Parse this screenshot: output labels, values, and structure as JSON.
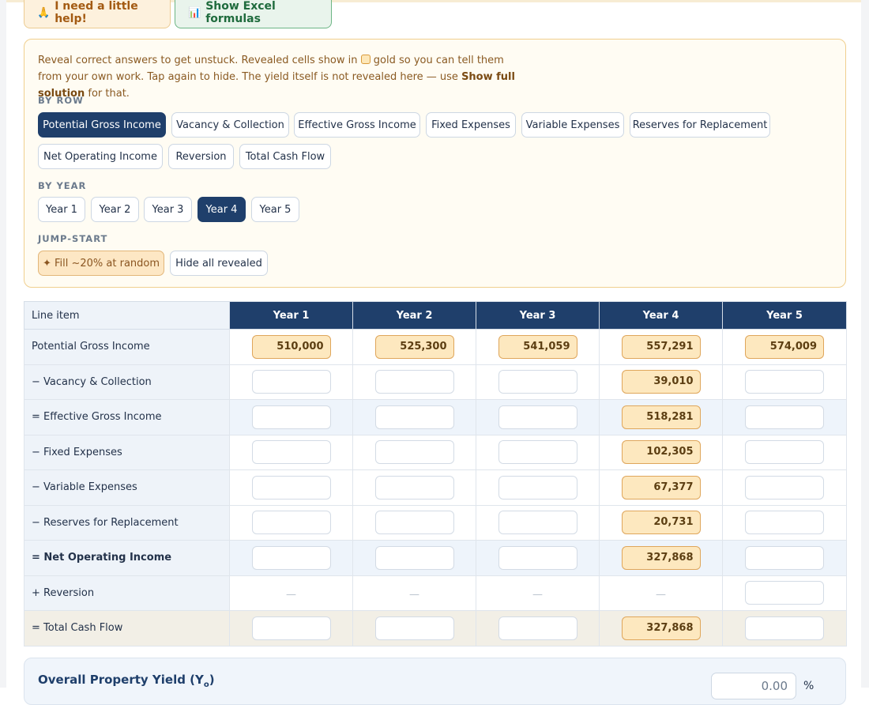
{
  "top_buttons": {
    "help": {
      "icon": "🙏",
      "label": "I need a little help!"
    },
    "excel": {
      "icon": "📊",
      "label": "Show Excel formulas"
    }
  },
  "help_panel": {
    "intro_before_square": "Reveal correct answers to get unstuck. Revealed cells show in",
    "intro_after_square": "gold so you can tell them from your own work. Tap again to hide. The yield itself is not revealed here — use",
    "intro_bold": "Show full solution",
    "intro_end": "for that.",
    "by_row_label": "BY ROW",
    "rows": [
      "Potential Gross Income",
      "Vacancy & Collection",
      "Effective Gross Income",
      "Fixed Expenses",
      "Variable Expenses",
      "Reserves for Replacement",
      "Net Operating Income",
      "Reversion",
      "Total Cash Flow"
    ],
    "active_row": "Potential Gross Income",
    "by_year_label": "BY YEAR",
    "years": [
      "Year 1",
      "Year 2",
      "Year 3",
      "Year 4",
      "Year 5"
    ],
    "active_year": "Year 4",
    "jump_label": "JUMP-START",
    "fill_random": "✦ Fill ~20% at random",
    "hide_all": "Hide all revealed"
  },
  "table": {
    "line_item_header": "Line item",
    "year_headers": [
      "Year 1",
      "Year 2",
      "Year 3",
      "Year 4",
      "Year 5"
    ],
    "rows": [
      {
        "label": "Potential Gross Income",
        "cells": [
          "510,000",
          "525,300",
          "541,059",
          "557,291",
          "574,009"
        ]
      },
      {
        "label": "− Vacancy & Collection",
        "cells": [
          "",
          "",
          "",
          "39,010",
          ""
        ]
      },
      {
        "label": "= Effective Gross Income",
        "cells": [
          "",
          "",
          "",
          "518,281",
          ""
        ]
      },
      {
        "label": "− Fixed Expenses",
        "cells": [
          "",
          "",
          "",
          "102,305",
          ""
        ]
      },
      {
        "label": "− Variable Expenses",
        "cells": [
          "",
          "",
          "",
          "67,377",
          ""
        ]
      },
      {
        "label": "− Reserves for Replacement",
        "cells": [
          "",
          "",
          "",
          "20,731",
          ""
        ]
      },
      {
        "label": "= Net Operating Income",
        "cells": [
          "",
          "",
          "",
          "327,868",
          ""
        ]
      },
      {
        "label": "+ Reversion",
        "cells": [
          "—",
          "—",
          "—",
          "—",
          ""
        ]
      },
      {
        "label": "= Total Cash Flow",
        "cells": [
          "",
          "",
          "",
          "327,868",
          ""
        ]
      }
    ]
  },
  "yield": {
    "title": "Overall Property Yield (Y",
    "sub": "o",
    "close": ")",
    "value": "0.00",
    "unit": "%"
  }
}
